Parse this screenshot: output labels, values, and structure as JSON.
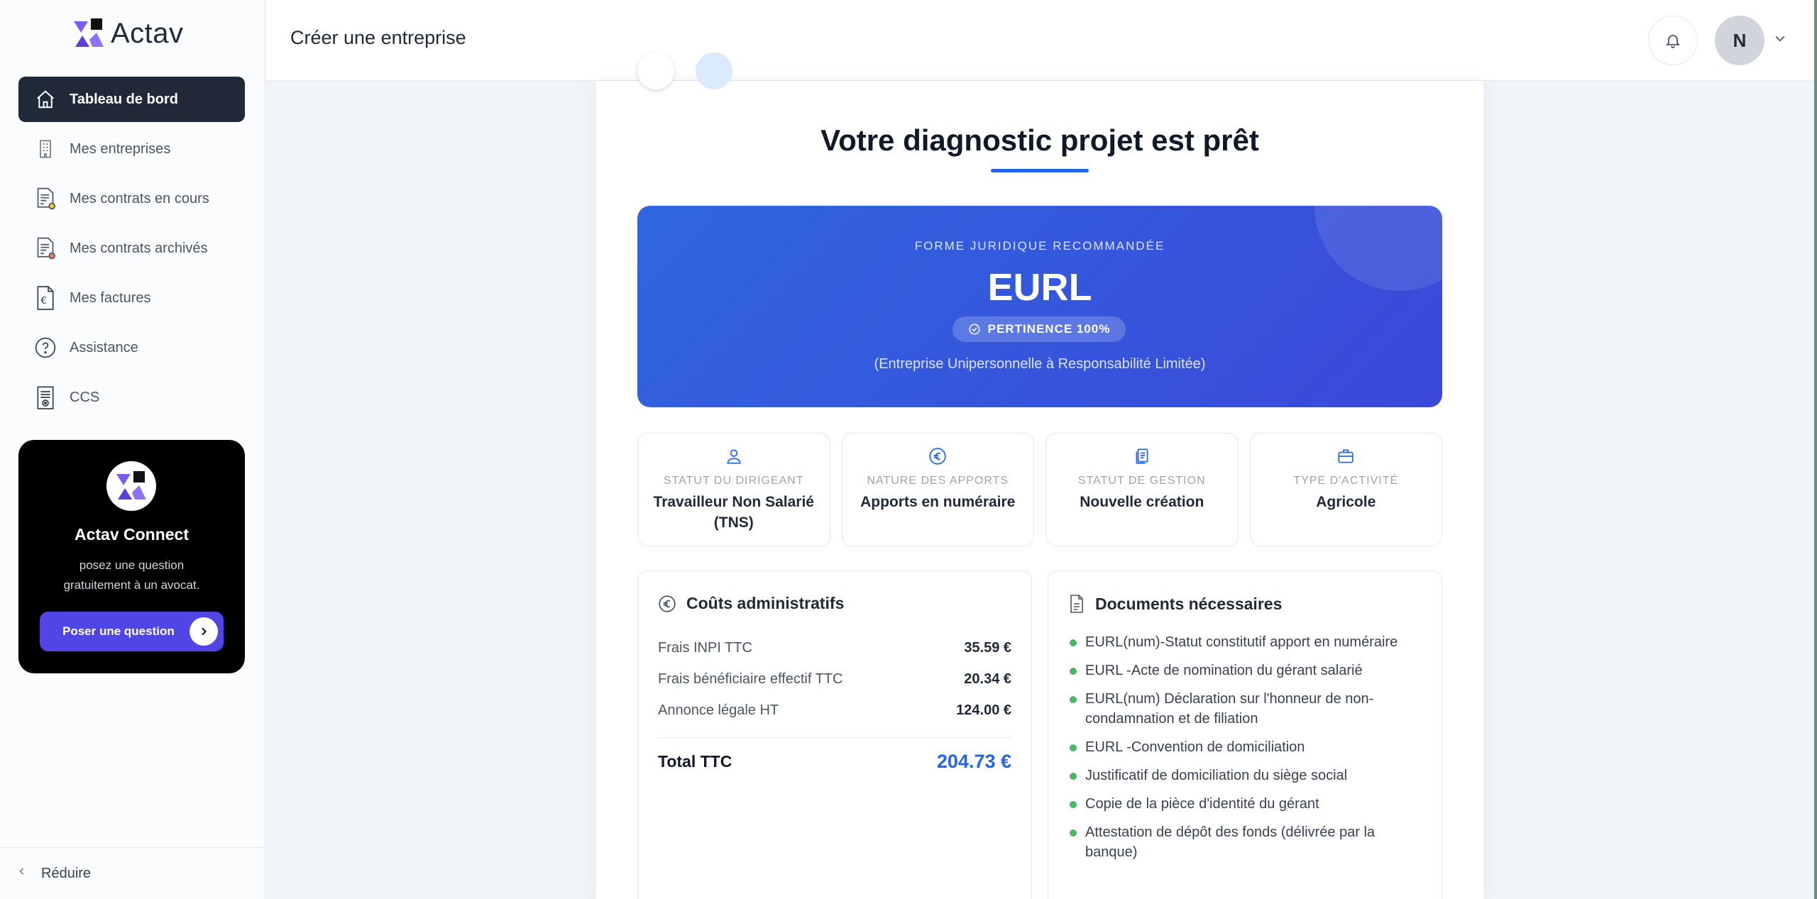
{
  "app": {
    "name": "Actav"
  },
  "sidebar": {
    "items": [
      {
        "label": "Tableau de bord",
        "icon": "home-icon",
        "active": true
      },
      {
        "label": "Mes entreprises",
        "icon": "building-icon"
      },
      {
        "label": "Mes contrats en cours",
        "icon": "contract-icon"
      },
      {
        "label": "Mes contrats archivés",
        "icon": "archive-contract-icon"
      },
      {
        "label": "Mes factures",
        "icon": "invoice-icon"
      },
      {
        "label": "Assistance",
        "icon": "help-icon"
      },
      {
        "label": "CCS",
        "icon": "document-icon"
      }
    ],
    "connect": {
      "title": "Actav Connect",
      "subtitle": "posez une question gratuitement à un avocat.",
      "button": "Poser une question"
    },
    "collapse_label": "Réduire"
  },
  "header": {
    "title": "Créer une entreprise",
    "avatar_initial": "N"
  },
  "diagnostic": {
    "title": "Votre diagnostic projet est prêt",
    "recommendation": {
      "label": "FORME JURIDIQUE RECOMMANDÉE",
      "value": "EURL",
      "badge": "PERTINENCE 100%",
      "description": "(Entreprise Unipersonnelle à Responsabilité Limitée)"
    },
    "info": [
      {
        "label": "STATUT DU DIRIGEANT",
        "value": "Travailleur Non Salarié (TNS)",
        "icon": "user-icon"
      },
      {
        "label": "NATURE DES APPORTS",
        "value": "Apports en numéraire",
        "icon": "euro-icon"
      },
      {
        "label": "STATUT DE GESTION",
        "value": "Nouvelle création",
        "icon": "clipboard-icon"
      },
      {
        "label": "TYPE D'ACTIVITÉ",
        "value": "Agricole",
        "icon": "briefcase-icon"
      }
    ],
    "costs": {
      "title": "Coûts administratifs",
      "rows": [
        {
          "label": "Frais INPI TTC",
          "amount": "35.59 €"
        },
        {
          "label": "Frais bénéficiaire effectif TTC",
          "amount": "20.34 €"
        },
        {
          "label": "Annonce légale HT",
          "amount": "124.00 €"
        }
      ],
      "total_label": "Total TTC",
      "total_amount": "204.73 €"
    },
    "documents": {
      "title": "Documents nécessaires",
      "items": [
        "EURL(num)-Statut constitutif apport en numéraire",
        "EURL -Acte de nomination du gérant salarié",
        "EURL(num) Déclaration sur l'honneur de non-condamnation et de filiation",
        "EURL -Convention de domiciliation",
        "Justificatif de domiciliation du siège social",
        "Copie de la pièce d'identité du gérant",
        "Attestation de dépôt des fonds (délivrée par la banque)"
      ]
    }
  },
  "colors": {
    "accent": "#2563eb",
    "sidebar_active": "#1f2937",
    "connect_button": "#4f46e5",
    "doc_bullet": "#4ab564"
  }
}
